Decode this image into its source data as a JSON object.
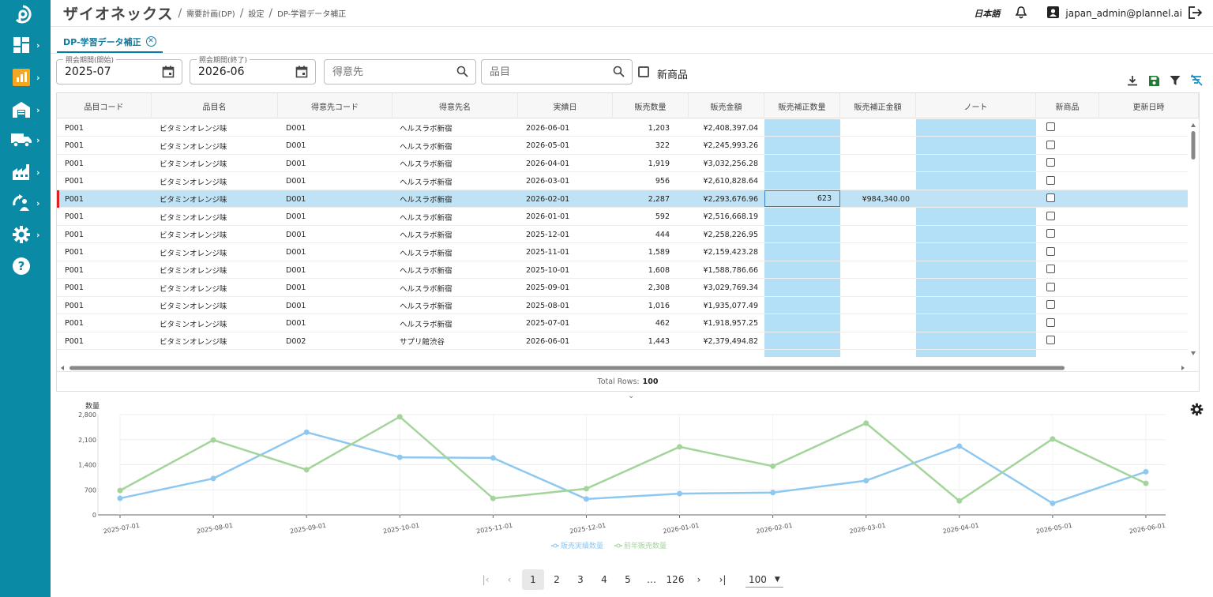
{
  "header": {
    "app_title": "ザイオネックス",
    "breadcrumbs": [
      "需要計画(DP)",
      "設定",
      "DP-学習データ補正"
    ],
    "language": "日本語",
    "user": "japan_admin@plannel.ai"
  },
  "tab": {
    "label": "DP-学習データ補正"
  },
  "filters": {
    "start_label": "照会期間(開始)",
    "start_value": "2025-07",
    "end_label": "照会期間(終了)",
    "end_value": "2026-06",
    "customer_placeholder": "得意先",
    "item_placeholder": "品目",
    "new_item_label": "新商品"
  },
  "colors": {
    "sidebar": "#0b8aa6",
    "accent": "#0b7a9e",
    "edit_column": "#b3e0f7",
    "selected_row": "#bfe3f5",
    "series_actual": "#8ec8f0",
    "series_prev": "#a3d49a"
  },
  "grid": {
    "columns": [
      "品目コード",
      "品目名",
      "得意先コード",
      "得意先名",
      "実績日",
      "販売数量",
      "販売金額",
      "販売補正数量",
      "販売補正金額",
      "ノート",
      "新商品",
      "更新日時"
    ],
    "rows": [
      [
        "P001",
        "ビタミンオレンジ味",
        "D001",
        "ヘルスラボ新宿",
        "2026-06-01",
        "1,203",
        "¥2,408,397.04",
        "",
        ""
      ],
      [
        "P001",
        "ビタミンオレンジ味",
        "D001",
        "ヘルスラボ新宿",
        "2026-05-01",
        "322",
        "¥2,245,993.26",
        "",
        ""
      ],
      [
        "P001",
        "ビタミンオレンジ味",
        "D001",
        "ヘルスラボ新宿",
        "2026-04-01",
        "1,919",
        "¥3,032,256.28",
        "",
        ""
      ],
      [
        "P001",
        "ビタミンオレンジ味",
        "D001",
        "ヘルスラボ新宿",
        "2026-03-01",
        "956",
        "¥2,610,828.64",
        "",
        ""
      ],
      [
        "P001",
        "ビタミンオレンジ味",
        "D001",
        "ヘルスラボ新宿",
        "2026-02-01",
        "2,287",
        "¥2,293,676.96",
        "623",
        "¥984,340.00"
      ],
      [
        "P001",
        "ビタミンオレンジ味",
        "D001",
        "ヘルスラボ新宿",
        "2026-01-01",
        "592",
        "¥2,516,668.19",
        "",
        ""
      ],
      [
        "P001",
        "ビタミンオレンジ味",
        "D001",
        "ヘルスラボ新宿",
        "2025-12-01",
        "444",
        "¥2,258,226.95",
        "",
        ""
      ],
      [
        "P001",
        "ビタミンオレンジ味",
        "D001",
        "ヘルスラボ新宿",
        "2025-11-01",
        "1,589",
        "¥2,159,423.28",
        "",
        ""
      ],
      [
        "P001",
        "ビタミンオレンジ味",
        "D001",
        "ヘルスラボ新宿",
        "2025-10-01",
        "1,608",
        "¥1,588,786.66",
        "",
        ""
      ],
      [
        "P001",
        "ビタミンオレンジ味",
        "D001",
        "ヘルスラボ新宿",
        "2025-09-01",
        "2,308",
        "¥3,029,769.34",
        "",
        ""
      ],
      [
        "P001",
        "ビタミンオレンジ味",
        "D001",
        "ヘルスラボ新宿",
        "2025-08-01",
        "1,016",
        "¥1,935,077.49",
        "",
        ""
      ],
      [
        "P001",
        "ビタミンオレンジ味",
        "D001",
        "ヘルスラボ新宿",
        "2025-07-01",
        "462",
        "¥1,918,957.25",
        "",
        ""
      ],
      [
        "P001",
        "ビタミンオレンジ味",
        "D002",
        "サプリ館渋谷",
        "2026-06-01",
        "1,443",
        "¥2,379,494.82",
        "",
        ""
      ]
    ],
    "selected_row": 4,
    "total_label": "Total Rows:",
    "total_value": "100"
  },
  "chart_data": {
    "type": "line",
    "ylabel": "数量",
    "ylim": [
      0,
      2800
    ],
    "yticks": [
      0,
      700,
      1400,
      2100,
      2800
    ],
    "ytick_labels": [
      "0",
      "700",
      "1,400",
      "2,100",
      "2,800"
    ],
    "categories": [
      "2025-07-01",
      "2025-08-01",
      "2025-09-01",
      "2025-10-01",
      "2025-11-01",
      "2025-12-01",
      "2026-01-01",
      "2026-02-01",
      "2026-03-01",
      "2026-04-01",
      "2026-05-01",
      "2026-06-01"
    ],
    "series": [
      {
        "name": "販売実績数量",
        "color": "#8ec8f0",
        "values": [
          462,
          1016,
          2308,
          1608,
          1589,
          444,
          592,
          623,
          956,
          1919,
          322,
          1203
        ]
      },
      {
        "name": "前年販売数量",
        "color": "#a3d49a",
        "values": [
          680,
          2090,
          1260,
          2740,
          460,
          730,
          1900,
          1360,
          2560,
          390,
          2120,
          880
        ]
      }
    ],
    "grid": true,
    "legend": "bottom-center"
  },
  "pager": {
    "pages": [
      "1",
      "2",
      "3",
      "4",
      "5",
      "…",
      "126"
    ],
    "current": "1",
    "page_size": "100"
  }
}
